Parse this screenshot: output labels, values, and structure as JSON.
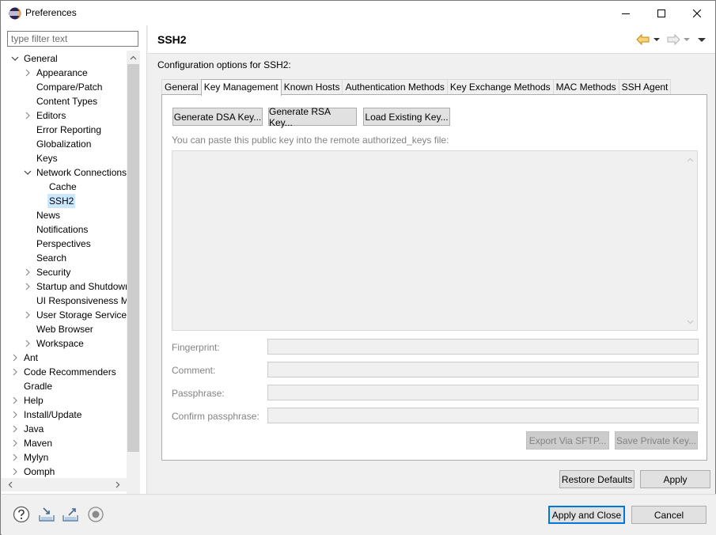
{
  "window": {
    "title": "Preferences"
  },
  "filter": {
    "placeholder": "type filter text"
  },
  "tree": [
    {
      "label": "General",
      "level": 0,
      "expanded": true
    },
    {
      "label": "Appearance",
      "level": 1,
      "twisty": "collapsed"
    },
    {
      "label": "Compare/Patch",
      "level": 1
    },
    {
      "label": "Content Types",
      "level": 1
    },
    {
      "label": "Editors",
      "level": 1,
      "twisty": "collapsed"
    },
    {
      "label": "Error Reporting",
      "level": 1
    },
    {
      "label": "Globalization",
      "level": 1
    },
    {
      "label": "Keys",
      "level": 1
    },
    {
      "label": "Network Connections",
      "level": 1,
      "expanded": true
    },
    {
      "label": "Cache",
      "level": 2
    },
    {
      "label": "SSH2",
      "level": 2,
      "selected": true
    },
    {
      "label": "News",
      "level": 1
    },
    {
      "label": "Notifications",
      "level": 1
    },
    {
      "label": "Perspectives",
      "level": 1
    },
    {
      "label": "Search",
      "level": 1
    },
    {
      "label": "Security",
      "level": 1,
      "twisty": "collapsed"
    },
    {
      "label": "Startup and Shutdown",
      "level": 1,
      "twisty": "collapsed"
    },
    {
      "label": "UI Responsiveness Monitoring",
      "level": 1
    },
    {
      "label": "User Storage Service",
      "level": 1,
      "twisty": "collapsed"
    },
    {
      "label": "Web Browser",
      "level": 1
    },
    {
      "label": "Workspace",
      "level": 1,
      "twisty": "collapsed"
    },
    {
      "label": "Ant",
      "level": 0,
      "twisty": "collapsed"
    },
    {
      "label": "Code Recommenders",
      "level": 0,
      "twisty": "collapsed"
    },
    {
      "label": "Gradle",
      "level": 0
    },
    {
      "label": "Help",
      "level": 0,
      "twisty": "collapsed"
    },
    {
      "label": "Install/Update",
      "level": 0,
      "twisty": "collapsed"
    },
    {
      "label": "Java",
      "level": 0,
      "twisty": "collapsed"
    },
    {
      "label": "Maven",
      "level": 0,
      "twisty": "collapsed"
    },
    {
      "label": "Mylyn",
      "level": 0,
      "twisty": "collapsed"
    },
    {
      "label": "Oomph",
      "level": 0,
      "twisty": "collapsed"
    }
  ],
  "page": {
    "title": "SSH2",
    "config_label": "Configuration options for SSH2:",
    "tabs": [
      {
        "label": "General"
      },
      {
        "label": "Key Management",
        "active": true
      },
      {
        "label": "Known Hosts"
      },
      {
        "label": "Authentication Methods"
      },
      {
        "label": "Key Exchange Methods"
      },
      {
        "label": "MAC Methods"
      },
      {
        "label": "SSH Agent"
      }
    ],
    "buttons": {
      "gen_dsa": "Generate DSA Key...",
      "gen_rsa": "Generate RSA Key...",
      "load_existing": "Load Existing Key...",
      "export_sftp": "Export Via SFTP...",
      "save_private": "Save Private Key..."
    },
    "hint": "You can paste this public key into the remote authorized_keys file:",
    "fields": {
      "fingerprint": "Fingerprint:",
      "comment": "Comment:",
      "passphrase": "Passphrase:",
      "confirm": "Confirm passphrase:"
    },
    "restore_defaults": "Restore Defaults",
    "apply": "Apply"
  },
  "footer": {
    "apply_close": "Apply and Close",
    "cancel": "Cancel"
  },
  "colors": {
    "selection": "#cce8ff",
    "focus_border": "#0078d7",
    "nav_back": "#e8a317"
  }
}
